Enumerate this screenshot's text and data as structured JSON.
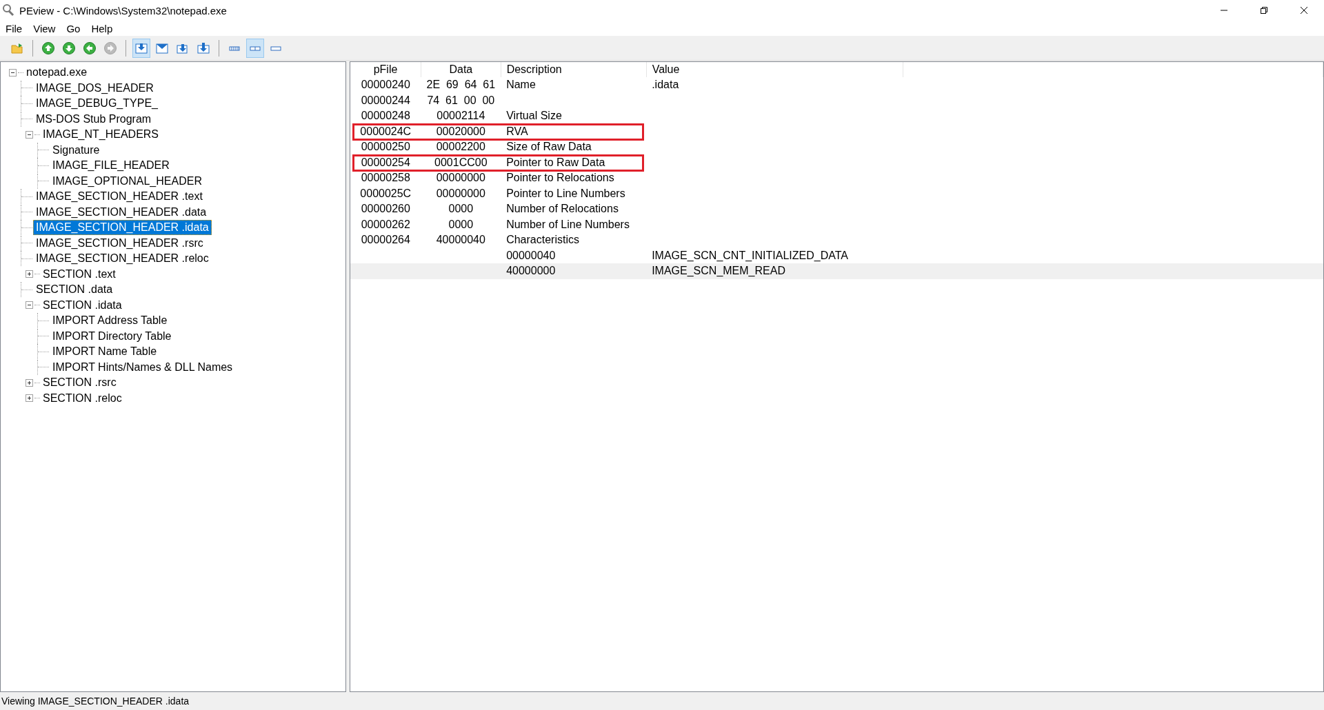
{
  "window": {
    "title": "PEview - C:\\Windows\\System32\\notepad.exe"
  },
  "menu": [
    {
      "label": "File"
    },
    {
      "label": "View"
    },
    {
      "label": "Go"
    },
    {
      "label": "Help"
    }
  ],
  "toolbar": [
    {
      "kind": "open",
      "pressed": false,
      "disabled": false
    },
    {
      "kind": "separator"
    },
    {
      "kind": "up",
      "pressed": false,
      "disabled": false
    },
    {
      "kind": "down",
      "pressed": false,
      "disabled": false
    },
    {
      "kind": "back",
      "pressed": false,
      "disabled": false
    },
    {
      "kind": "forward",
      "pressed": false,
      "disabled": true
    },
    {
      "kind": "separator"
    },
    {
      "kind": "view-a",
      "pressed": true,
      "disabled": false
    },
    {
      "kind": "view-b",
      "pressed": false,
      "disabled": false
    },
    {
      "kind": "view-c",
      "pressed": false,
      "disabled": false
    },
    {
      "kind": "view-d",
      "pressed": false,
      "disabled": false
    },
    {
      "kind": "separator"
    },
    {
      "kind": "bytes",
      "pressed": false,
      "disabled": false
    },
    {
      "kind": "words",
      "pressed": true,
      "disabled": false
    },
    {
      "kind": "dwords",
      "pressed": false,
      "disabled": false
    }
  ],
  "tree": [
    {
      "label": "notepad.exe",
      "selected": false,
      "expanded": true,
      "children": [
        {
          "label": "IMAGE_DOS_HEADER",
          "selected": false
        },
        {
          "label": "IMAGE_DEBUG_TYPE_",
          "selected": false
        },
        {
          "label": "MS-DOS Stub Program",
          "selected": false
        },
        {
          "label": "IMAGE_NT_HEADERS",
          "selected": false,
          "expanded": true,
          "children": [
            {
              "label": "Signature",
              "selected": false
            },
            {
              "label": "IMAGE_FILE_HEADER",
              "selected": false
            },
            {
              "label": "IMAGE_OPTIONAL_HEADER",
              "selected": false
            }
          ]
        },
        {
          "label": "IMAGE_SECTION_HEADER .text",
          "selected": false
        },
        {
          "label": "IMAGE_SECTION_HEADER .data",
          "selected": false
        },
        {
          "label": "IMAGE_SECTION_HEADER .idata",
          "selected": true
        },
        {
          "label": "IMAGE_SECTION_HEADER .rsrc",
          "selected": false
        },
        {
          "label": "IMAGE_SECTION_HEADER .reloc",
          "selected": false
        },
        {
          "label": "SECTION .text",
          "selected": false,
          "expanded": false
        },
        {
          "label": "SECTION .data",
          "selected": false
        },
        {
          "label": "SECTION .idata",
          "selected": false,
          "expanded": true,
          "children": [
            {
              "label": "IMPORT Address Table",
              "selected": false
            },
            {
              "label": "IMPORT Directory Table",
              "selected": false
            },
            {
              "label": "IMPORT Name Table",
              "selected": false
            },
            {
              "label": "IMPORT Hints/Names & DLL Names",
              "selected": false
            }
          ]
        },
        {
          "label": "SECTION .rsrc",
          "selected": false,
          "expanded": false
        },
        {
          "label": "SECTION .reloc",
          "selected": false,
          "expanded": false
        }
      ]
    }
  ],
  "table": {
    "columns": [
      "pFile",
      "Data",
      "Description",
      "Value"
    ],
    "rows": [
      {
        "pfile": "00000240",
        "data": "2E  69  64  61",
        "description": "Name",
        "value": ".idata",
        "highlighted": false,
        "selected": false
      },
      {
        "pfile": "00000244",
        "data": "74  61  00  00",
        "highlighted": false,
        "selected": false
      },
      {
        "pfile": "00000248",
        "data": "00002114",
        "description": "Virtual Size",
        "highlighted": false,
        "selected": false
      },
      {
        "pfile": "0000024C",
        "data": "00020000",
        "description": "RVA",
        "highlighted": true,
        "selected": false
      },
      {
        "pfile": "00000250",
        "data": "00002200",
        "description": "Size of Raw Data",
        "highlighted": false,
        "selected": false
      },
      {
        "pfile": "00000254",
        "data": "0001CC00",
        "description": "Pointer to Raw Data",
        "highlighted": true,
        "selected": false
      },
      {
        "pfile": "00000258",
        "data": "00000000",
        "description": "Pointer to Relocations",
        "highlighted": false,
        "selected": false
      },
      {
        "pfile": "0000025C",
        "data": "00000000",
        "description": "Pointer to Line Numbers",
        "highlighted": false,
        "selected": false
      },
      {
        "pfile": "00000260",
        "data": "0000",
        "description": "Number of Relocations",
        "highlighted": false,
        "selected": false
      },
      {
        "pfile": "00000262",
        "data": "0000",
        "description": "Number of Line Numbers",
        "highlighted": false,
        "selected": false
      },
      {
        "pfile": "00000264",
        "data": "40000040",
        "description": "Characteristics",
        "highlighted": false,
        "selected": false
      },
      {
        "description": "00000040",
        "value": "IMAGE_SCN_CNT_INITIALIZED_DATA",
        "highlighted": false,
        "selected": false
      },
      {
        "description": "40000000",
        "value": "IMAGE_SCN_MEM_READ",
        "highlighted": false,
        "selected": true
      }
    ]
  },
  "status_bar": {
    "text": "Viewing IMAGE_SECTION_HEADER .idata"
  }
}
